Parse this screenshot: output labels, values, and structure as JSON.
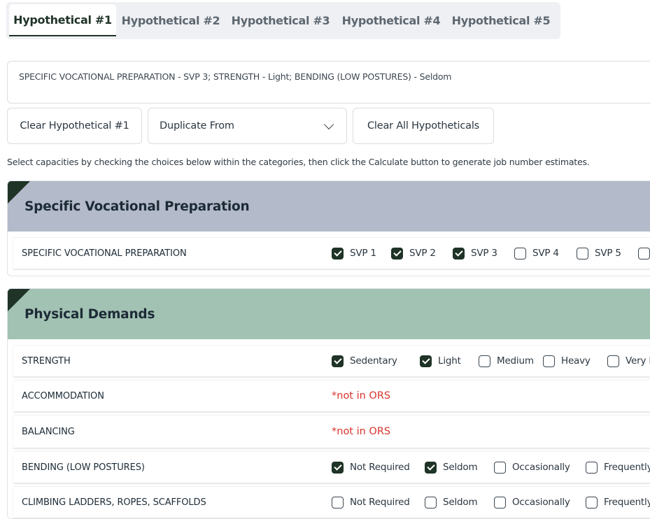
{
  "tabs": [
    "Hypothetical #1",
    "Hypothetical #2",
    "Hypothetical #3",
    "Hypothetical #4",
    "Hypothetical #5"
  ],
  "summary": "SPECIFIC VOCATIONAL PREPARATION - SVP 3; STRENGTH - Light; BENDING (LOW POSTURES) -  Seldom",
  "buttons": {
    "clear_current": "Clear Hypothetical #1",
    "duplicate_from": "Duplicate From",
    "clear_all": "Clear All Hypotheticals"
  },
  "instructions": "Select capacities by checking the choices below within the categories, then click the Calculate button to generate job number estimates.",
  "colors": {
    "accent": "#1f3327",
    "svp_header": "#b3bac9",
    "physical_header": "#a2c2b3",
    "not_in_ors": "#d9342b"
  },
  "sections": {
    "svp": {
      "title": "Specific Vocational Preparation",
      "rows": [
        {
          "label": "SPECIFIC VOCATIONAL PREPARATION",
          "options": [
            {
              "label": "SVP 1",
              "checked": true
            },
            {
              "label": "SVP 2",
              "checked": true
            },
            {
              "label": "SVP 3",
              "checked": true
            },
            {
              "label": "SVP 4",
              "checked": false
            },
            {
              "label": "SVP 5",
              "checked": false
            },
            {
              "label": "",
              "checked": false
            }
          ]
        }
      ]
    },
    "physical": {
      "title": "Physical Demands",
      "rows": [
        {
          "label": "STRENGTH",
          "options": [
            {
              "label": "Sedentary",
              "checked": true
            },
            {
              "label": "Light",
              "checked": true
            },
            {
              "label": "Medium",
              "checked": false
            },
            {
              "label": "Heavy",
              "checked": false
            },
            {
              "label": "Very H",
              "checked": false
            }
          ]
        },
        {
          "label": "ACCOMMODATION",
          "note": "*not in ORS"
        },
        {
          "label": "BALANCING",
          "note": "*not in ORS"
        },
        {
          "label": "BENDING (LOW POSTURES)",
          "options": [
            {
              "label": "Not Required",
              "checked": true
            },
            {
              "label": "Seldom",
              "checked": true
            },
            {
              "label": "Occasionally",
              "checked": false
            },
            {
              "label": "Frequently",
              "checked": false
            }
          ]
        },
        {
          "label": "CLIMBING LADDERS, ROPES, SCAFFOLDS",
          "options": [
            {
              "label": "Not Required",
              "checked": false
            },
            {
              "label": "Seldom",
              "checked": false
            },
            {
              "label": "Occasionally",
              "checked": false
            },
            {
              "label": "Frequently",
              "checked": false
            }
          ]
        }
      ]
    }
  }
}
